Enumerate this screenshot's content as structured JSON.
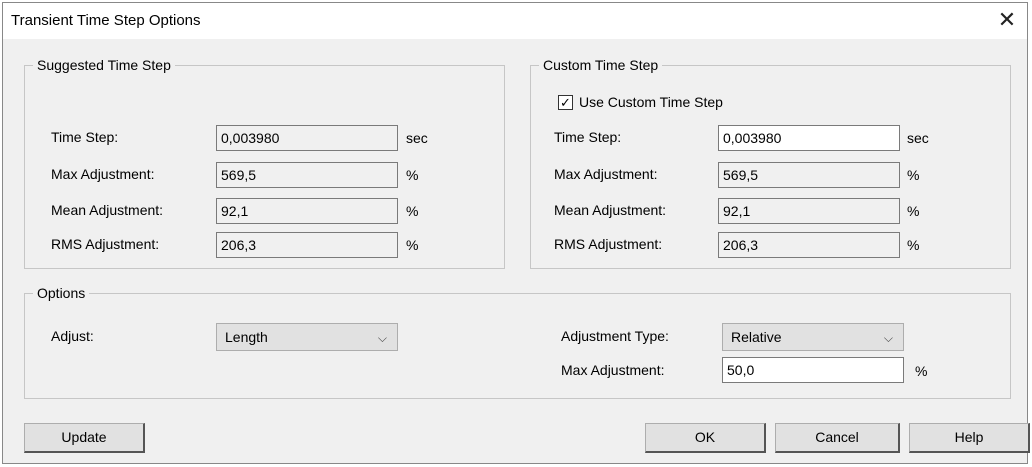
{
  "window": {
    "title": "Transient Time Step Options",
    "close_glyph": "✕"
  },
  "suggested": {
    "legend": "Suggested Time Step",
    "rows": [
      {
        "label": "Time Step:",
        "value": "0,003980",
        "unit": "sec"
      },
      {
        "label": "Max Adjustment:",
        "value": "569,5",
        "unit": "%"
      },
      {
        "label": "Mean Adjustment:",
        "value": "92,1",
        "unit": "%"
      },
      {
        "label": "RMS Adjustment:",
        "value": "206,3",
        "unit": "%"
      }
    ]
  },
  "custom": {
    "legend": "Custom Time Step",
    "checkbox_label": "Use Custom Time Step",
    "checkbox_checked": true,
    "check_glyph": "✓",
    "rows": [
      {
        "label": "Time Step:",
        "value": "0,003980",
        "unit": "sec"
      },
      {
        "label": "Max Adjustment:",
        "value": "569,5",
        "unit": "%"
      },
      {
        "label": "Mean Adjustment:",
        "value": "92,1",
        "unit": "%"
      },
      {
        "label": "RMS Adjustment:",
        "value": "206,3",
        "unit": "%"
      }
    ]
  },
  "options": {
    "legend": "Options",
    "adjust_label": "Adjust:",
    "adjust_value": "Length",
    "adjustment_type_label": "Adjustment Type:",
    "adjustment_type_value": "Relative",
    "max_adjustment_label": "Max Adjustment:",
    "max_adjustment_value": "50,0",
    "max_adjustment_unit": "%",
    "chevron_glyph": "⌵"
  },
  "buttons": {
    "update": "Update",
    "ok": "OK",
    "cancel": "Cancel",
    "help": "Help"
  }
}
